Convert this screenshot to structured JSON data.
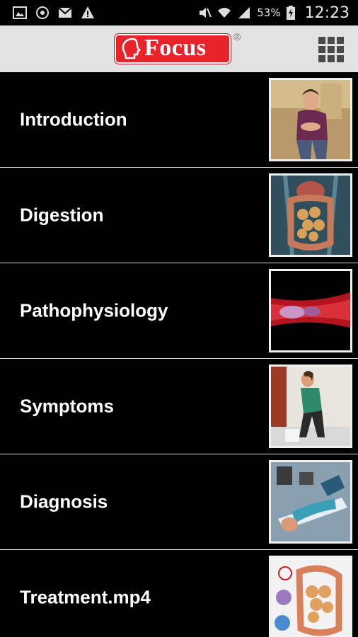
{
  "status_bar": {
    "battery_percent": "53%",
    "time": "12:23"
  },
  "header": {
    "logo_text": "Focus",
    "logo_mark": "®",
    "menu_icon": "grid-icon"
  },
  "items": [
    {
      "label": "Introduction",
      "thumbnail": "man-holding-stomach"
    },
    {
      "label": "Digestion",
      "thumbnail": "intestine-anatomy"
    },
    {
      "label": "Pathophysiology",
      "thumbnail": "intestinal-wall"
    },
    {
      "label": "Symptoms",
      "thumbnail": "woman-toilet"
    },
    {
      "label": "Diagnosis",
      "thumbnail": "patient-colonoscopy"
    },
    {
      "label": "Treatment.mp4",
      "thumbnail": "intestine-treatment"
    }
  ],
  "colors": {
    "brand_red": "#e8232a",
    "header_bg": "#e3e3e3",
    "list_bg": "#000000",
    "divider": "#d9d9d9"
  }
}
